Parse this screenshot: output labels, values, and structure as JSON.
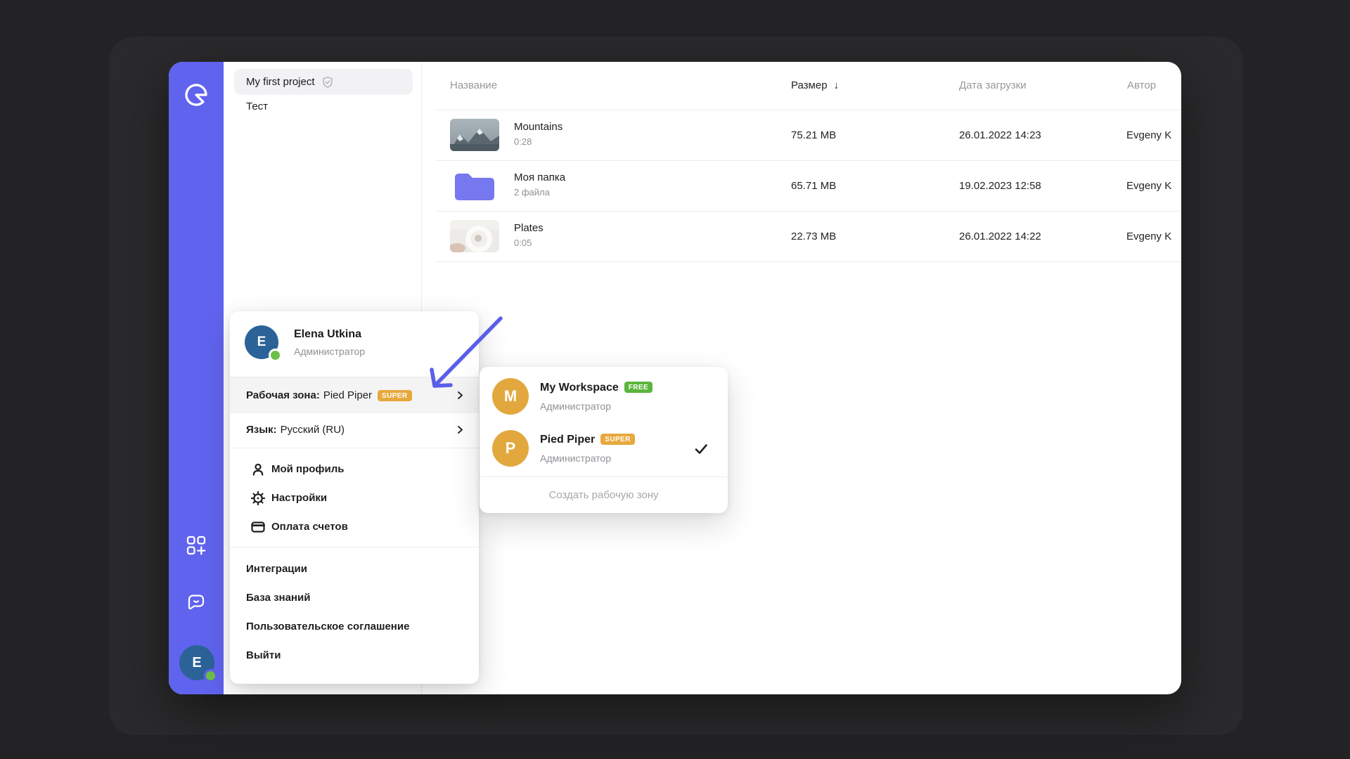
{
  "colors": {
    "rail_purple": "#6063ee",
    "arrow_annotation": "#5a5ee8",
    "avatar_blue": "#2b6398",
    "avatar_orange": "#e2a83d",
    "badge_free_green": "#5cb53c",
    "badge_super_orange": "#e6a93d",
    "online_green": "#6dbf45",
    "folder_purple": "#7578ee"
  },
  "rail": {
    "avatar_initial": "E"
  },
  "projects": {
    "active": {
      "label": "My first project"
    },
    "second": {
      "label": "Тест"
    }
  },
  "table": {
    "columns": {
      "name": "Название",
      "size": "Размер",
      "sort_icon": "↓",
      "date": "Дата загрузки",
      "author": "Автор"
    },
    "rows": [
      {
        "name": "Mountains",
        "meta": "0:28",
        "size": "75.21 MB",
        "date": "26.01.2022 14:23",
        "author": "Evgeny K"
      },
      {
        "name": "Моя папка",
        "meta": "2 файла",
        "size": "65.71 MB",
        "date": "19.02.2023 12:58",
        "author": "Evgeny K"
      },
      {
        "name": "Plates",
        "meta": "0:05",
        "size": "22.73 MB",
        "date": "26.01.2022 14:22",
        "author": "Evgeny K"
      }
    ]
  },
  "user_menu": {
    "user": {
      "name": "Elena Utkina",
      "role": "Администратор",
      "initial": "E"
    },
    "workspace_row": {
      "label": "Рабочая зона:",
      "value": "Pied Piper",
      "badge": "SUPER"
    },
    "language_row": {
      "label": "Язык:",
      "value": "Русский (RU)"
    },
    "account_items": [
      {
        "label": "Мой профиль"
      },
      {
        "label": "Настройки"
      },
      {
        "label": "Оплата счетов"
      }
    ],
    "footer_items": [
      {
        "label": "Интеграции"
      },
      {
        "label": "База знаний"
      },
      {
        "label": "Пользовательское соглашение"
      },
      {
        "label": "Выйти"
      }
    ]
  },
  "workspace_menu": {
    "items": [
      {
        "initial": "M",
        "name": "My Workspace",
        "badge": "FREE",
        "role": "Администратор"
      },
      {
        "initial": "P",
        "name": "Pied Piper",
        "badge": "SUPER",
        "role": "Администратор"
      }
    ],
    "create_label": "Создать рабочую зону"
  }
}
